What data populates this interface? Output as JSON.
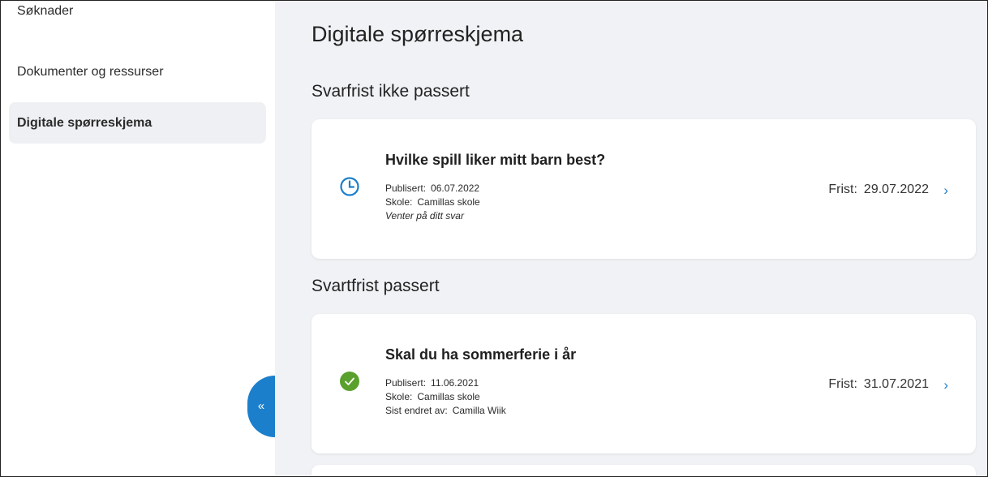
{
  "sidebar": {
    "items": [
      {
        "label": "Søknader"
      },
      {
        "label": "Dokumenter og ressurser"
      },
      {
        "label": "Digitale spørreskjema",
        "active": true
      }
    ],
    "collapse_glyph": "«"
  },
  "main": {
    "title": "Digitale spørreskjema",
    "sections": [
      {
        "title": "Svarfrist ikke passert",
        "cards": [
          {
            "icon": "clock-icon",
            "title": "Hvilke spill liker mitt barn best?",
            "published_label": "Publisert:",
            "published_value": "06.07.2022",
            "school_label": "Skole:",
            "school_value": "Camillas skole",
            "status_text": "Venter på ditt svar",
            "deadline_label": "Frist:",
            "deadline_value": "29.07.2022"
          }
        ]
      },
      {
        "title": "Svartfrist passert",
        "cards": [
          {
            "icon": "check-circle-icon",
            "title": "Skal du ha sommerferie i år",
            "published_label": "Publisert:",
            "published_value": "11.06.2021",
            "school_label": "Skole:",
            "school_value": "Camillas skole",
            "changed_label": "Sist endret av:",
            "changed_value": "Camilla Wiik",
            "deadline_label": "Frist:",
            "deadline_value": "31.07.2021"
          }
        ]
      }
    ]
  },
  "colors": {
    "accent": "#1b7fcc",
    "success": "#5aa02c",
    "background": "#f0f2f5"
  }
}
